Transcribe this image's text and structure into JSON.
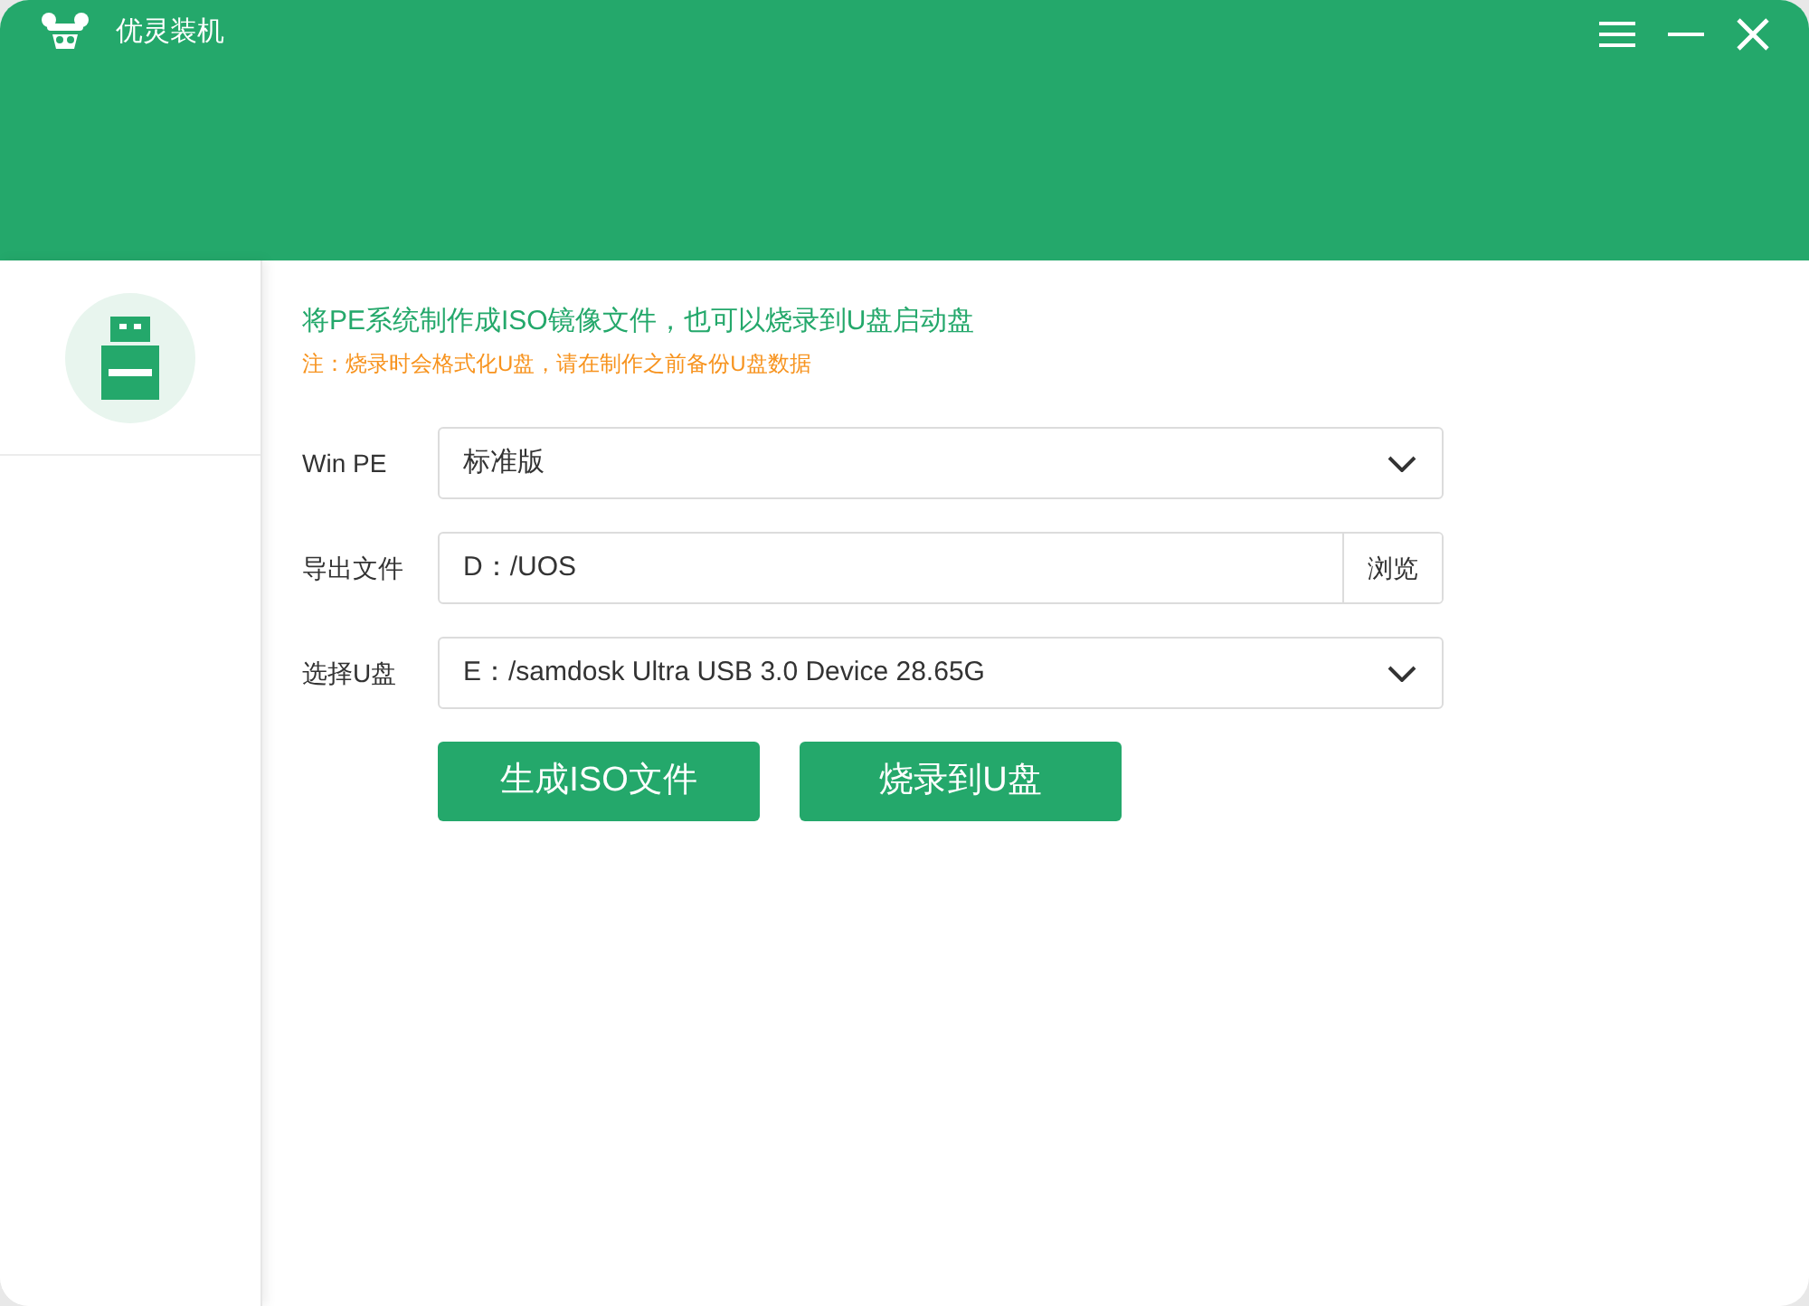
{
  "window": {
    "title": "优灵装机"
  },
  "sidebar": {
    "items": [
      {
        "kind": "usb",
        "selected": true
      }
    ]
  },
  "intro": {
    "headline": "将PE系统制作成ISO镜像文件，也可以烧录到U盘启动盘",
    "warning": "注：烧录时会格式化U盘，请在制作之前备份U盘数据"
  },
  "form": [
    {
      "kind": "dropdown",
      "label": "Win PE",
      "value": "标准版"
    },
    {
      "kind": "path",
      "label": "导出文件",
      "value": "D：/UOS",
      "button": "浏览"
    },
    {
      "kind": "dropdown",
      "label": "选择U盘",
      "value": "E：/samdosk Ultra USB 3.0 Device 28.65G"
    }
  ],
  "buttons": [
    "生成ISO文件",
    "烧录到U盘"
  ]
}
